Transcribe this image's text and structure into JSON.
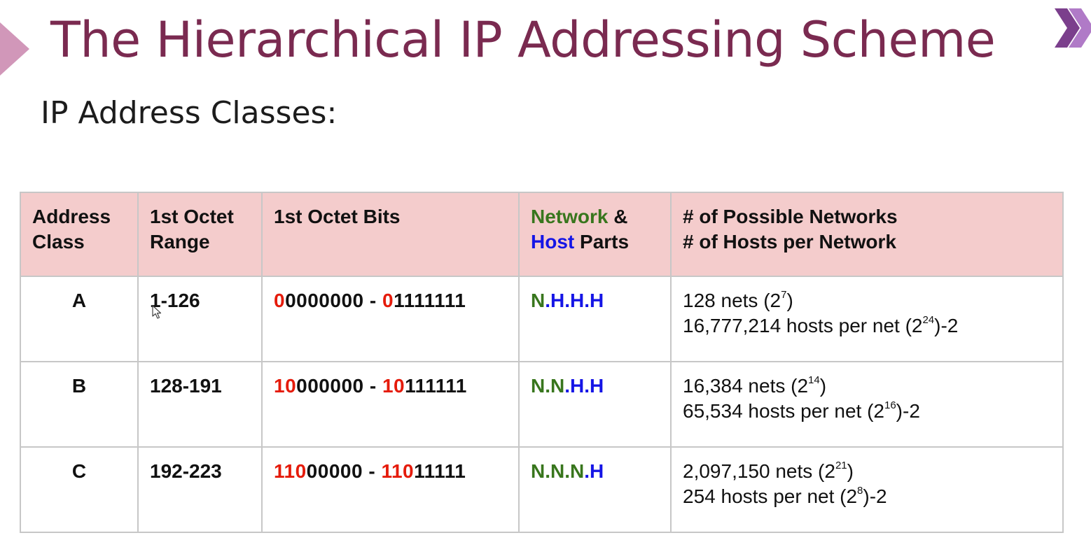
{
  "title": "The Hierarchical IP Addressing Scheme",
  "subtitle": "IP Address Classes:",
  "colors": {
    "title": "#7a2a50",
    "header_bg": "#f4cccc",
    "network": "#38761d",
    "host": "#1515e6",
    "bits_highlight": "#e51b0b",
    "chevron": "#d197b9"
  },
  "icons": {
    "left_nav": "chevron-right-icon",
    "right_nav": "double-chevron-right-icon",
    "pointer": "mouse-cursor-icon"
  },
  "table": {
    "headers": {
      "address_class": [
        "Address",
        "Class"
      ],
      "range": [
        "1st Octet",
        "Range"
      ],
      "bits": "1st Octet Bits",
      "parts": {
        "network": "Network",
        "amp": " &",
        "host": "Host",
        "parts": " Parts"
      },
      "counts": [
        "# of Possible Networks",
        "# of Hosts per Network"
      ]
    },
    "rows": [
      {
        "class": "A",
        "range": "1-126",
        "bits_from": {
          "hl": "0",
          "rest": "0000000"
        },
        "bits_to": {
          "hl": "0",
          "rest": "1111111"
        },
        "sep": " - ",
        "parts": {
          "net": "N",
          "host": ".H.H.H"
        },
        "nets": {
          "pre": "128 nets (2",
          "exp": "7",
          "post": ")"
        },
        "hosts": {
          "pre": "16,777,214 hosts per net (2",
          "exp": "24",
          "post": ")-2"
        }
      },
      {
        "class": "B",
        "range": "128-191",
        "bits_from": {
          "hl": "10",
          "rest": "000000"
        },
        "bits_to": {
          "hl": "10",
          "rest": "111111"
        },
        "sep": " - ",
        "parts": {
          "net": "N.N",
          "host": ".H.H"
        },
        "nets": {
          "pre": "16,384 nets (2",
          "exp": "14",
          "post": ")"
        },
        "hosts": {
          "pre": "65,534 hosts per net (2",
          "exp": "16",
          "post": ")-2"
        }
      },
      {
        "class": "C",
        "range": "192-223",
        "bits_from": {
          "hl": "110",
          "rest": "00000"
        },
        "bits_to": {
          "hl": "110",
          "rest": "11111"
        },
        "sep": " - ",
        "parts": {
          "net": "N.N.N",
          "host": ".H"
        },
        "nets": {
          "pre": "2,097,150 nets (2",
          "exp": "21",
          "post": ")"
        },
        "hosts": {
          "pre": "254 hosts per net (2",
          "exp": "8",
          "post": ")-2"
        }
      }
    ]
  }
}
